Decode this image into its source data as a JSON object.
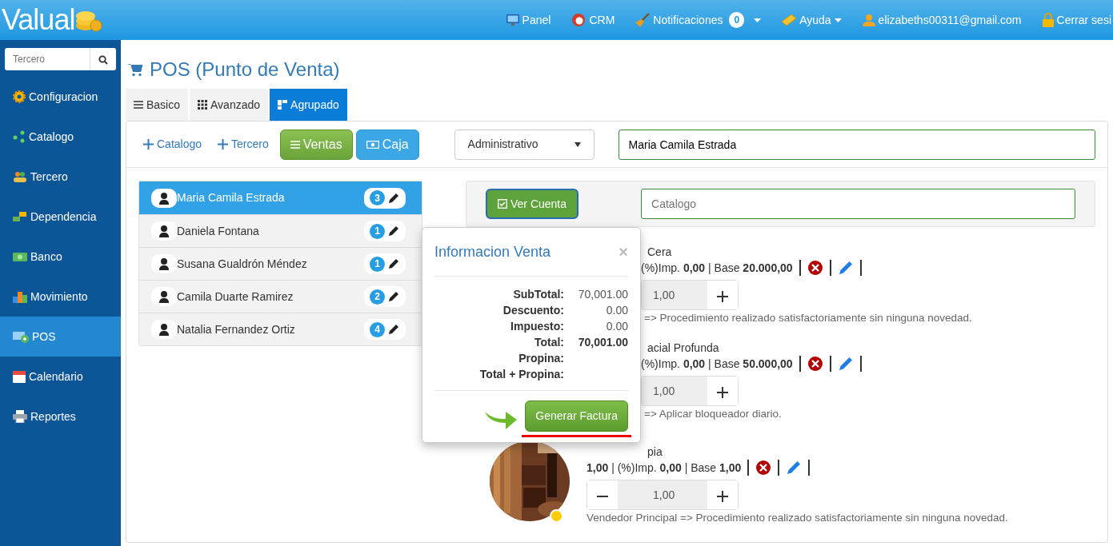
{
  "navbar": {
    "brand": "Valual",
    "items": [
      {
        "label": "Panel"
      },
      {
        "label": "CRM"
      },
      {
        "label": "Notificaciones",
        "badge": "0",
        "dropdown": true
      },
      {
        "label": "Ayuda",
        "dropdown": true
      },
      {
        "label": "elizabeths00311@gmail.com"
      },
      {
        "label": "Cerrar sesi"
      }
    ]
  },
  "sidebar": {
    "search": {
      "placeholder": "Tercero"
    },
    "items": [
      {
        "label": "Configuracion",
        "selected": false
      },
      {
        "label": "Catalogo",
        "selected": false
      },
      {
        "label": "Tercero",
        "selected": false
      },
      {
        "label": "Dependencia",
        "selected": false
      },
      {
        "label": "Banco",
        "selected": false
      },
      {
        "label": "Movimiento",
        "selected": false
      },
      {
        "label": "POS",
        "selected": true
      },
      {
        "label": "Calendario",
        "selected": false
      },
      {
        "label": "Reportes",
        "selected": false
      }
    ]
  },
  "page_title": "POS (Punto de Venta)",
  "tabs": [
    {
      "label": "Basico",
      "selected": false
    },
    {
      "label": "Avanzado",
      "selected": false
    },
    {
      "label": "Agrupado",
      "selected": true
    }
  ],
  "toolbar": {
    "links": [
      "Catalogo",
      "Tercero"
    ],
    "buttons": [
      {
        "label": "Ventas",
        "kind": "success"
      },
      {
        "label": "Caja",
        "kind": "info"
      }
    ],
    "select": {
      "value": "Administrativo"
    },
    "customer_field": {
      "value": "Maria Camila Estrada"
    }
  },
  "customers": [
    {
      "name": "Maria Camila Estrada",
      "count": "3",
      "selected": true
    },
    {
      "name": "Daniela Fontana",
      "count": "1",
      "selected": false
    },
    {
      "name": "Susana Gualdrón Méndez",
      "count": "1",
      "selected": false
    },
    {
      "name": "Camila Duarte Ramirez",
      "count": "2",
      "selected": false
    },
    {
      "name": "Natalia Fernandez Ortiz",
      "count": "4",
      "selected": false
    }
  ],
  "cart": {
    "view_button": "Ver Cuenta",
    "catalog_field": {
      "placeholder": "Catalogo"
    },
    "items": [
      {
        "kind": "covered",
        "title": "Cera",
        "meta": "(%)Imp. **0,00** | Base **20.000,00**",
        "quantity": "1,00",
        "note": "=> Procedimiento realizado satisfactoriamente sin ninguna novedad."
      },
      {
        "kind": "covered",
        "title": "acial Profunda",
        "meta": "(%)Imp. **0,00** | Base **50.000,00**",
        "quantity": "1,00",
        "note": "=> Aplicar bloqueador diario."
      },
      {
        "kind": "full",
        "title": "pia",
        "meta": "**1,00** | (%)Imp. **0,00** | Base **1,00**",
        "quantity": "1,00",
        "note": "Vendedor Principal => Procedimiento realizado satisfactoriamente sin ninguna novedad.",
        "color": "#ffcc00"
      }
    ]
  },
  "popover": {
    "title": "Informacion Venta",
    "close": "×",
    "rows": [
      {
        "label": "SubTotal:",
        "value": "70,001.00",
        "bold": false
      },
      {
        "label": "Descuento:",
        "value": "0.00",
        "bold": false
      },
      {
        "label": "Impuesto:",
        "value": "0.00",
        "bold": false
      },
      {
        "label": "Total:",
        "value": "70,001.00",
        "bold": true
      },
      {
        "label": "Propina:"
      },
      {
        "label": "Total + Propina:"
      }
    ],
    "button": "Generar Factura"
  }
}
